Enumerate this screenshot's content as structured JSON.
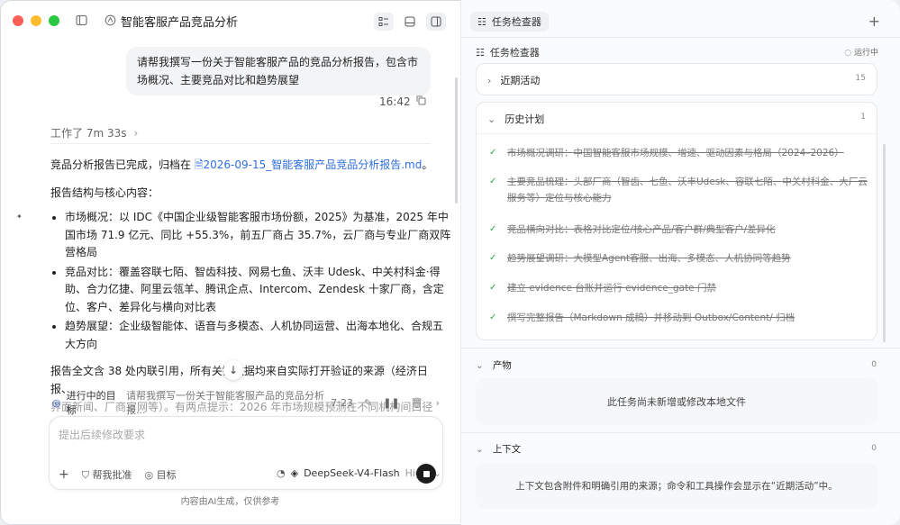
{
  "window": {
    "title": "智能客服产品竞品分析"
  },
  "chat": {
    "user_message": "请帮我撰写一份关于智能客服产品的竞品分析报告，包含市场概况、主要竞品对比和趋势展望",
    "time": "16:42",
    "worked_label": "工作了 7m 33s",
    "intro_prefix": "竞品分析报告已完成，归档在 ",
    "report_file": "2026-09-15_智能客服产品竞品分析报告.md",
    "intro_suffix": "。",
    "structure_label": "报告结构与核心内容：",
    "points": [
      "市场概况：以 IDC《中国企业级智能客服市场份额，2025》为基准，2025 年中国市场 71.9 亿元、同比 +55.3%，前五厂商占 35.7%，云厂商与专业厂商双阵营格局",
      "竞品对比：覆盖容联七陌、智齿科技、网易七鱼、沃丰 Udesk、中关村科金·得助、合力亿捷、阿里云瓴羊、腾讯企点、Intercom、Zendesk 十家厂商，含定位、客户、差异化与横向对比表",
      "趋势展望：企业级智能体、语音与多模态、人机协同运营、出海本地化、合规五大方向"
    ],
    "closing_line1": "报告全文含 38 处内联引用，所有关键数据均来自实际打开验证的来源（经济日报、",
    "closing_line2": "界面新闻、厂商官网等）。有两点提示：2026 年市场规模预测在不同机构间口径不一"
  },
  "goal_bar": {
    "label": "进行中的目标",
    "desc": "请帮我撰写一份关于智能客服产品的竞品分析报...",
    "time": "7:23"
  },
  "composer": {
    "placeholder": "提出后续修改要求",
    "approve_label": "帮我批准",
    "goal_label": "目标",
    "model_name": "DeepSeek-V4-Flash",
    "model_level": "High"
  },
  "disclaimer": "内容由AI生成，仅供参考",
  "right_panel": {
    "tab_label": "任务检查器",
    "header_title": "任务检查器",
    "status": "运行中",
    "recent_label": "近期活动",
    "recent_count": "15",
    "history_label": "历史计划",
    "history_count": "1",
    "plan_items": [
      "市场概况调研：中国智能客服市场规模、增速、驱动因素与格局（2024–2026）",
      "主要竞品梳理：头部厂商（智齿、七鱼、沃丰Udesk、容联七陌、中关村科金、大厂云服务等）定位与核心能力",
      "竞品横向对比：表格对比定位/核心产品/客户群/典型客户/差异化",
      "趋势展望调研：大模型Agent客服、出海、多模态、人机协同等趋势",
      "建立 evidence 台账并运行 evidence_gate 门禁",
      "撰写完整报告（Markdown 成稿）并移动到 Outbox/Content/ 归档"
    ],
    "artifacts_label": "产物",
    "artifacts_count": "0",
    "artifacts_empty": "此任务尚未新增或修改本地文件",
    "context_label": "上下文",
    "context_count": "0",
    "context_empty": "上下文包含附件和明确引用的来源；命令和工具操作会显示在“近期活动”中。"
  }
}
